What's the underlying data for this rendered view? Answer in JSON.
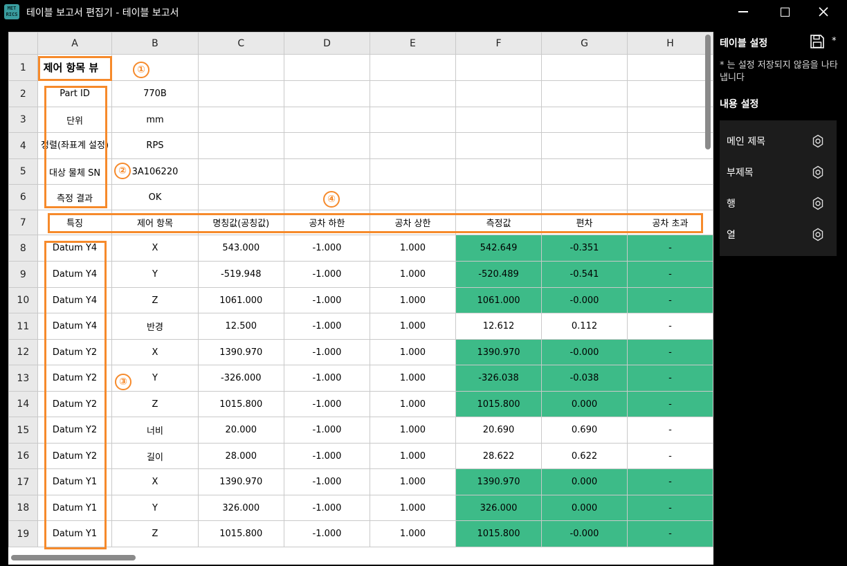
{
  "window": {
    "title": "테이블 보고서 편집기 - 테이블 보고서",
    "app_icon_text": "MET RICS",
    "colors": {
      "background": "#000000",
      "accent": "#f68a2b",
      "pass": "#3dbb88"
    }
  },
  "sheet": {
    "col_headers": [
      "A",
      "B",
      "C",
      "D",
      "E",
      "F",
      "G",
      "H"
    ],
    "rows": [
      {
        "n": "1",
        "cells": [
          "제어 항목 뷰",
          "",
          "",
          "",
          "",
          "",
          "",
          ""
        ]
      },
      {
        "n": "2",
        "cells": [
          "Part ID",
          "770B",
          "",
          "",
          "",
          "",
          "",
          ""
        ]
      },
      {
        "n": "3",
        "cells": [
          "단위",
          "mm",
          "",
          "",
          "",
          "",
          "",
          ""
        ]
      },
      {
        "n": "4",
        "cells": [
          "정렬(좌표계 설정)",
          "RPS",
          "",
          "",
          "",
          "",
          "",
          ""
        ]
      },
      {
        "n": "5",
        "cells": [
          "대상 물체 SN",
          "3A106220",
          "",
          "",
          "",
          "",
          "",
          ""
        ]
      },
      {
        "n": "6",
        "cells": [
          "측정 결과",
          "OK",
          "",
          "",
          "",
          "",
          "",
          ""
        ]
      },
      {
        "n": "7",
        "cells": [
          "특징",
          "제어 항목",
          "명칭값(공칭값)",
          "공차 하한",
          "공차 상한",
          "측정값",
          "편차",
          "공차 초과"
        ]
      },
      {
        "n": "8",
        "cells": [
          "Datum Y4",
          "X",
          "543.000",
          "-1.000",
          "1.000",
          "542.649",
          "-0.351",
          "-"
        ],
        "pass": true
      },
      {
        "n": "9",
        "cells": [
          "Datum Y4",
          "Y",
          "-519.948",
          "-1.000",
          "1.000",
          "-520.489",
          "-0.541",
          "-"
        ],
        "pass": true
      },
      {
        "n": "10",
        "cells": [
          "Datum Y4",
          "Z",
          "1061.000",
          "-1.000",
          "1.000",
          "1061.000",
          "-0.000",
          "-"
        ],
        "pass": true
      },
      {
        "n": "11",
        "cells": [
          "Datum Y4",
          "반경",
          "12.500",
          "-1.000",
          "1.000",
          "12.612",
          "0.112",
          "-"
        ],
        "pass": false
      },
      {
        "n": "12",
        "cells": [
          "Datum Y2",
          "X",
          "1390.970",
          "-1.000",
          "1.000",
          "1390.970",
          "-0.000",
          "-"
        ],
        "pass": true
      },
      {
        "n": "13",
        "cells": [
          "Datum Y2",
          "Y",
          "-326.000",
          "-1.000",
          "1.000",
          "-326.038",
          "-0.038",
          "-"
        ],
        "pass": true
      },
      {
        "n": "14",
        "cells": [
          "Datum Y2",
          "Z",
          "1015.800",
          "-1.000",
          "1.000",
          "1015.800",
          "0.000",
          "-"
        ],
        "pass": true
      },
      {
        "n": "15",
        "cells": [
          "Datum Y2",
          "너비",
          "20.000",
          "-1.000",
          "1.000",
          "20.690",
          "0.690",
          "-"
        ],
        "pass": false
      },
      {
        "n": "16",
        "cells": [
          "Datum Y2",
          "길이",
          "28.000",
          "-1.000",
          "1.000",
          "28.622",
          "0.622",
          "-"
        ],
        "pass": false
      },
      {
        "n": "17",
        "cells": [
          "Datum Y1",
          "X",
          "1390.970",
          "-1.000",
          "1.000",
          "1390.970",
          "0.000",
          "-"
        ],
        "pass": true
      },
      {
        "n": "18",
        "cells": [
          "Datum Y1",
          "Y",
          "326.000",
          "-1.000",
          "1.000",
          "326.000",
          "0.000",
          "-"
        ],
        "pass": true
      },
      {
        "n": "19",
        "cells": [
          "Datum Y1",
          "Z",
          "1015.800",
          "-1.000",
          "1.000",
          "1015.800",
          "-0.000",
          "-"
        ],
        "pass": true
      }
    ]
  },
  "annotations": {
    "m1": "①",
    "m2": "②",
    "m3": "③",
    "m4": "④"
  },
  "panel": {
    "title": "테이블 설정",
    "unsaved_mark": "*",
    "note": "* 는 설정 저장되지 않음을 나타냅니다",
    "content_title": "내용 설정",
    "items": [
      {
        "label": "메인 제목",
        "icon": "gear-icon"
      },
      {
        "label": "부제목",
        "icon": "gear-icon"
      },
      {
        "label": "행",
        "icon": "gear-icon"
      },
      {
        "label": "열",
        "icon": "gear-icon"
      }
    ]
  }
}
